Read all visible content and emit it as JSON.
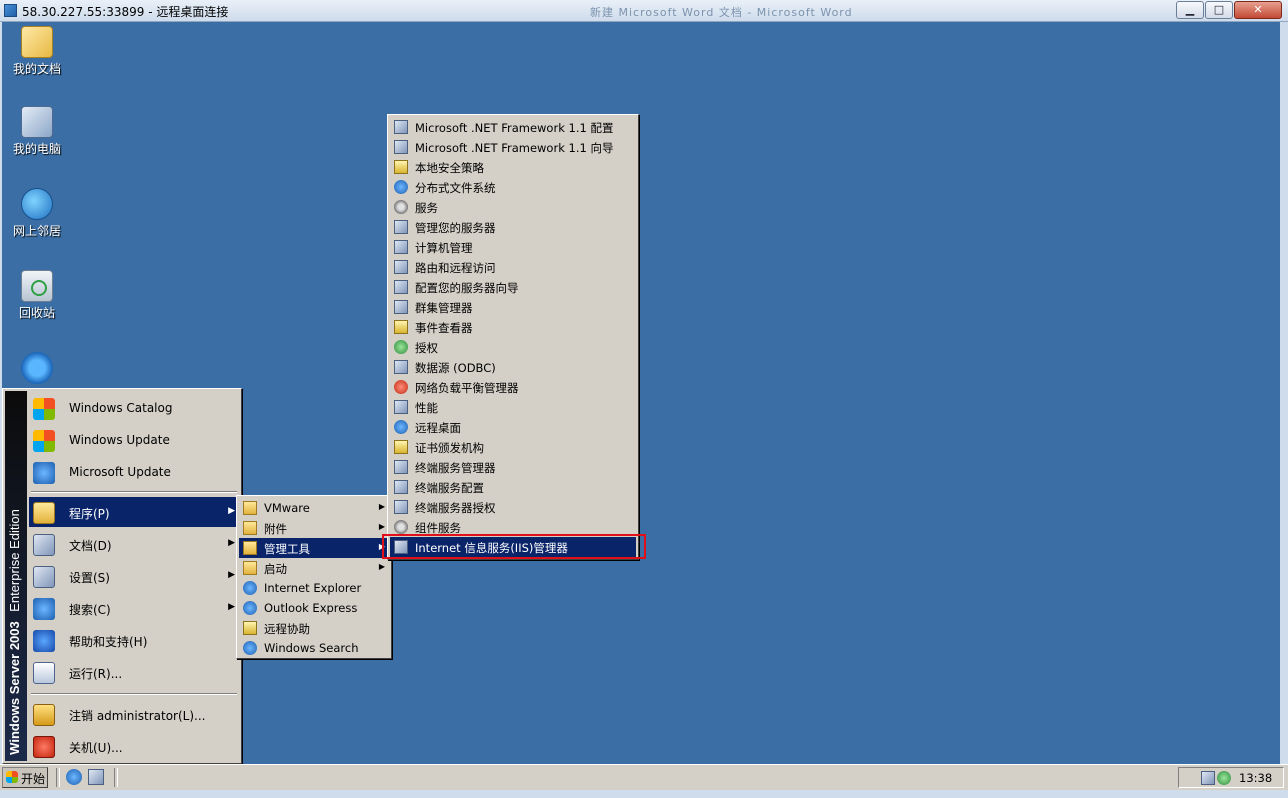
{
  "window": {
    "title": "58.30.227.55:33899 - 远程桌面连接",
    "ghost_title": "新建 Microsoft Word 文档 - Microsoft Word",
    "minimize": "▁",
    "maximize": "□",
    "close": "✕"
  },
  "desktop_icons": [
    {
      "label": "我的文档",
      "icon": "my-documents-icon"
    },
    {
      "label": "我的电脑",
      "icon": "my-computer-icon"
    },
    {
      "label": "网上邻居",
      "icon": "network-places-icon"
    },
    {
      "label": "回收站",
      "icon": "recycle-bin-icon"
    },
    {
      "label": "",
      "icon": "internet-explorer-icon"
    }
  ],
  "start_menu": {
    "banner_main": "Windows Server 2003",
    "banner_sub": "Enterprise Edition",
    "top_items": [
      {
        "label": "Windows Catalog",
        "icon": "windows-catalog-icon"
      },
      {
        "label": "Windows Update",
        "icon": "windows-update-icon"
      },
      {
        "label": "Microsoft Update",
        "icon": "microsoft-update-icon"
      }
    ],
    "items": [
      {
        "label": "程序(P)",
        "icon": "programs-icon",
        "arrow": "▶"
      },
      {
        "label": "文档(D)",
        "icon": "documents-icon",
        "arrow": "▶"
      },
      {
        "label": "设置(S)",
        "icon": "settings-icon",
        "arrow": "▶"
      },
      {
        "label": "搜索(C)",
        "icon": "search-icon",
        "arrow": "▶"
      },
      {
        "label": "帮助和支持(H)",
        "icon": "help-icon"
      },
      {
        "label": "运行(R)...",
        "icon": "run-icon"
      }
    ],
    "bottom_items": [
      {
        "label": "注销 administrator(L)...",
        "icon": "logoff-icon"
      },
      {
        "label": "关机(U)...",
        "icon": "shutdown-icon"
      }
    ]
  },
  "programs_menu": [
    {
      "label": "VMware",
      "arrow": "▶"
    },
    {
      "label": "附件",
      "arrow": "▶"
    },
    {
      "label": "管理工具",
      "arrow": "▶"
    },
    {
      "label": "启动",
      "arrow": "▶"
    },
    {
      "label": "Internet Explorer"
    },
    {
      "label": "Outlook Express"
    },
    {
      "label": "远程协助"
    },
    {
      "label": "Windows Search"
    }
  ],
  "admin_tools_menu": [
    "Microsoft .NET Framework 1.1 配置",
    "Microsoft .NET Framework 1.1 向导",
    "本地安全策略",
    "分布式文件系统",
    "服务",
    "管理您的服务器",
    "计算机管理",
    "路由和远程访问",
    "配置您的服务器向导",
    "群集管理器",
    "事件查看器",
    "授权",
    "数据源 (ODBC)",
    "网络负载平衡管理器",
    "性能",
    "远程桌面",
    "证书颁发机构",
    "终端服务管理器",
    "终端服务配置",
    "终端服务器授权",
    "组件服务",
    "Internet 信息服务(IIS)管理器"
  ],
  "taskbar": {
    "start_label": "开始",
    "clock": "13:38"
  }
}
